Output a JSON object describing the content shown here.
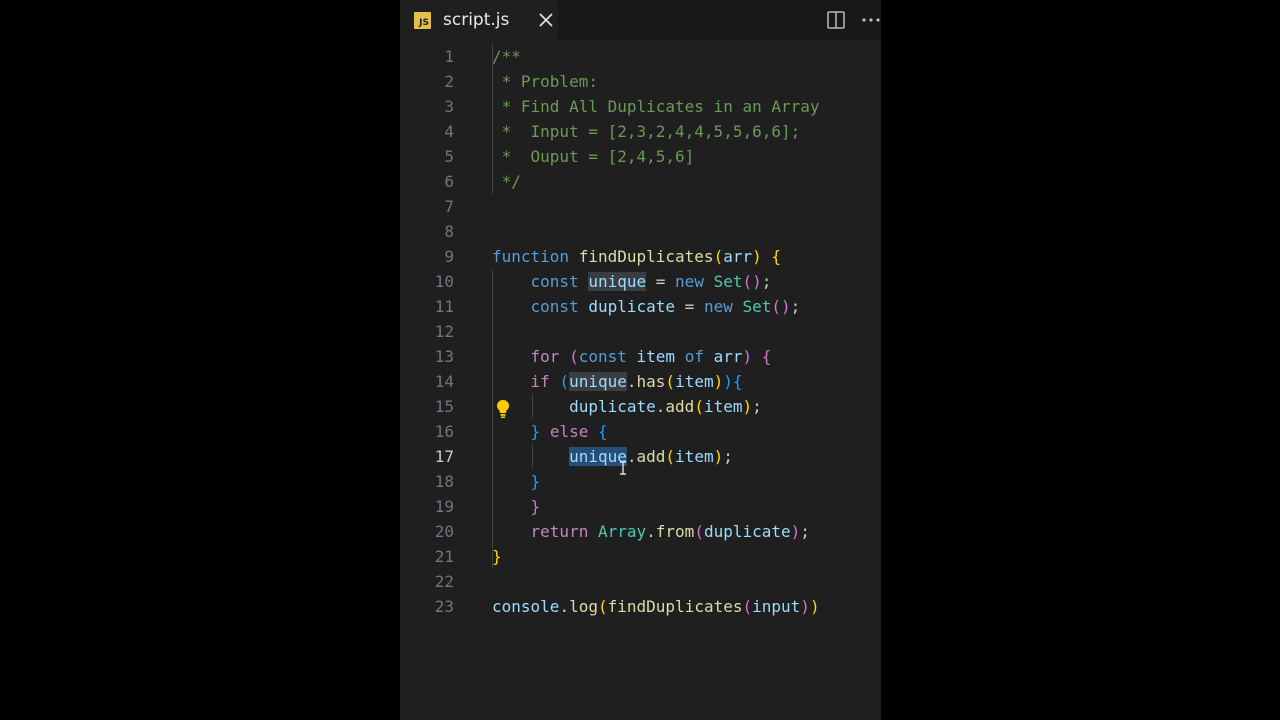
{
  "tab": {
    "icon_label": "JS",
    "filename": "script.js"
  },
  "icons": {
    "tab_close": "close-icon",
    "split": "split-editor-icon",
    "more": "more-actions-icon",
    "bulb": "lightbulb-icon"
  },
  "code": {
    "active_line": 17,
    "lines": [
      {
        "n": "1",
        "tokens": [
          [
            "c",
            "/**"
          ]
        ]
      },
      {
        "n": "2",
        "tokens": [
          [
            "c",
            " * Problem:"
          ]
        ]
      },
      {
        "n": "3",
        "tokens": [
          [
            "c",
            " * Find All Duplicates in an Array"
          ]
        ]
      },
      {
        "n": "4",
        "tokens": [
          [
            "c",
            " *  Input = [2,3,2,4,4,5,5,6,6];"
          ]
        ]
      },
      {
        "n": "5",
        "tokens": [
          [
            "c",
            " *  Ouput = [2,4,5,6]"
          ]
        ]
      },
      {
        "n": "6",
        "tokens": [
          [
            "c",
            " */"
          ]
        ]
      },
      {
        "n": "7",
        "tokens": []
      },
      {
        "n": "8",
        "tokens": []
      },
      {
        "n": "9",
        "tokens": [
          [
            "k",
            "function"
          ],
          [
            "pl",
            " "
          ],
          [
            "f",
            "findDuplicates"
          ],
          [
            "b1",
            "("
          ],
          [
            "v",
            "arr"
          ],
          [
            "b1",
            ")"
          ],
          [
            "pl",
            " "
          ],
          [
            "b1",
            "{"
          ]
        ]
      },
      {
        "n": "10",
        "tokens": [
          [
            "pl",
            "    "
          ],
          [
            "k",
            "const"
          ],
          [
            "pl",
            " "
          ],
          [
            "v hl",
            "unique"
          ],
          [
            "pl",
            " = "
          ],
          [
            "k",
            "new"
          ],
          [
            "pl",
            " "
          ],
          [
            "cls",
            "Set"
          ],
          [
            "b2",
            "()"
          ],
          [
            "pl",
            ";"
          ]
        ]
      },
      {
        "n": "11",
        "tokens": [
          [
            "pl",
            "    "
          ],
          [
            "k",
            "const"
          ],
          [
            "pl",
            " "
          ],
          [
            "v",
            "duplicate"
          ],
          [
            "pl",
            " = "
          ],
          [
            "k",
            "new"
          ],
          [
            "pl",
            " "
          ],
          [
            "cls",
            "Set"
          ],
          [
            "b2",
            "()"
          ],
          [
            "pl",
            ";"
          ]
        ]
      },
      {
        "n": "12",
        "tokens": []
      },
      {
        "n": "13",
        "tokens": [
          [
            "pl",
            "    "
          ],
          [
            "ctl",
            "for"
          ],
          [
            "pl",
            " "
          ],
          [
            "b2",
            "("
          ],
          [
            "k",
            "const"
          ],
          [
            "pl",
            " "
          ],
          [
            "v",
            "item"
          ],
          [
            "pl",
            " "
          ],
          [
            "k",
            "of"
          ],
          [
            "pl",
            " "
          ],
          [
            "v",
            "arr"
          ],
          [
            "b2",
            ")"
          ],
          [
            "pl",
            " "
          ],
          [
            "b2",
            "{"
          ]
        ]
      },
      {
        "n": "14",
        "tokens": [
          [
            "pl",
            "    "
          ],
          [
            "ctl",
            "if"
          ],
          [
            "pl",
            " "
          ],
          [
            "b3",
            "("
          ],
          [
            "v hl",
            "unique"
          ],
          [
            "pl",
            "."
          ],
          [
            "f",
            "has"
          ],
          [
            "b1",
            "("
          ],
          [
            "v",
            "item"
          ],
          [
            "b1",
            ")"
          ],
          [
            "b3",
            ")"
          ],
          [
            "b3",
            "{"
          ]
        ]
      },
      {
        "n": "15",
        "tokens": [
          [
            "pl",
            "        "
          ],
          [
            "v",
            "duplicate"
          ],
          [
            "pl",
            "."
          ],
          [
            "f",
            "add"
          ],
          [
            "b1",
            "("
          ],
          [
            "v",
            "item"
          ],
          [
            "b1",
            ")"
          ],
          [
            "pl",
            ";"
          ]
        ]
      },
      {
        "n": "16",
        "tokens": [
          [
            "pl",
            "    "
          ],
          [
            "b3",
            "}"
          ],
          [
            "pl",
            " "
          ],
          [
            "ctl",
            "else"
          ],
          [
            "pl",
            " "
          ],
          [
            "b3",
            "{"
          ]
        ]
      },
      {
        "n": "17",
        "tokens": [
          [
            "pl",
            "        "
          ],
          [
            "v sel",
            "unique"
          ],
          [
            "pl",
            "."
          ],
          [
            "f",
            "add"
          ],
          [
            "b1",
            "("
          ],
          [
            "v",
            "item"
          ],
          [
            "b1",
            ")"
          ],
          [
            "pl",
            ";"
          ]
        ]
      },
      {
        "n": "18",
        "tokens": [
          [
            "pl",
            "    "
          ],
          [
            "b3",
            "}"
          ]
        ]
      },
      {
        "n": "19",
        "tokens": [
          [
            "pl",
            "    "
          ],
          [
            "b2",
            "}"
          ]
        ]
      },
      {
        "n": "20",
        "tokens": [
          [
            "pl",
            "    "
          ],
          [
            "ctl",
            "return"
          ],
          [
            "pl",
            " "
          ],
          [
            "cls",
            "Array"
          ],
          [
            "pl",
            "."
          ],
          [
            "f",
            "from"
          ],
          [
            "b2",
            "("
          ],
          [
            "v",
            "duplicate"
          ],
          [
            "b2",
            ")"
          ],
          [
            "pl",
            ";"
          ]
        ]
      },
      {
        "n": "21",
        "tokens": [
          [
            "b1",
            "}"
          ]
        ]
      },
      {
        "n": "22",
        "tokens": []
      },
      {
        "n": "23",
        "tokens": [
          [
            "v",
            "console"
          ],
          [
            "pl",
            "."
          ],
          [
            "f",
            "log"
          ],
          [
            "b1",
            "("
          ],
          [
            "f",
            "findDuplicates"
          ],
          [
            "b2",
            "("
          ],
          [
            "v",
            "input"
          ],
          [
            "b2",
            ")"
          ],
          [
            "b1",
            ")"
          ]
        ]
      }
    ]
  }
}
